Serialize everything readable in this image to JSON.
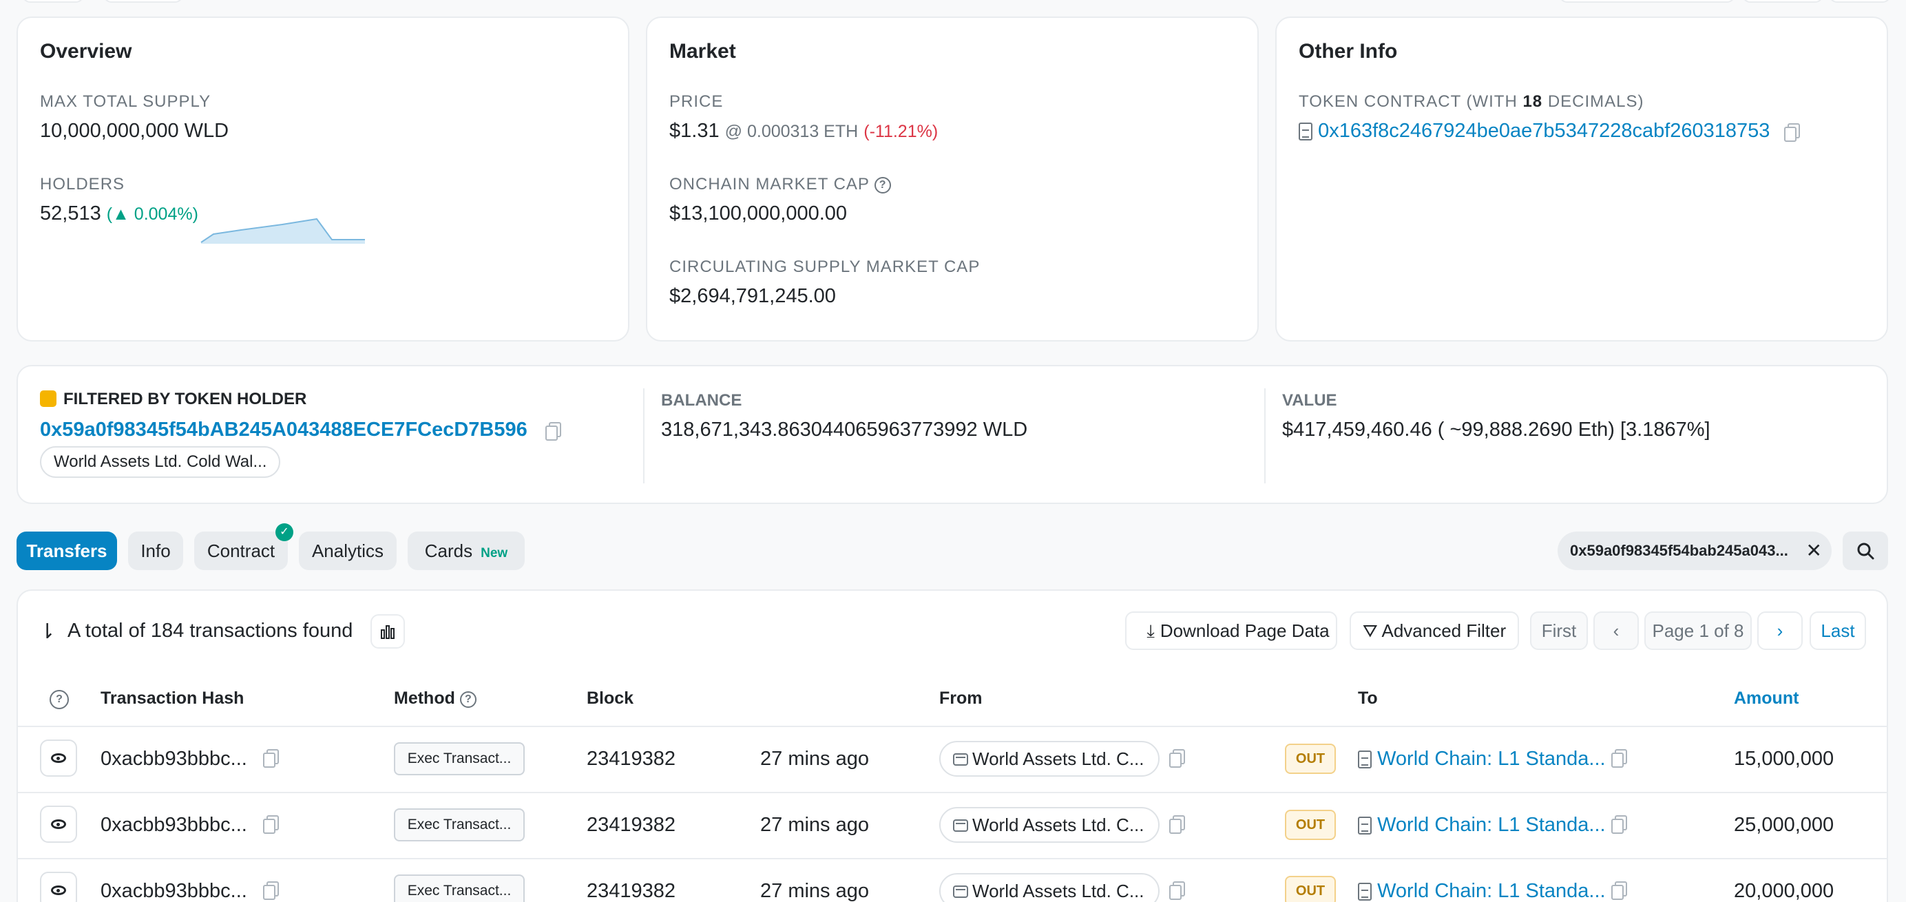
{
  "overview": {
    "title": "Overview",
    "max_supply_label": "MAX TOTAL SUPPLY",
    "max_supply_value": "10,000,000,000 WLD",
    "holders_label": "HOLDERS",
    "holders_value": "52,513",
    "holders_change": "0.004%"
  },
  "market": {
    "title": "Market",
    "price_label": "PRICE",
    "price_value": "$1.31",
    "price_eth": "@ 0.000313 ETH",
    "price_change": "(-11.21%)",
    "mcap_label": "ONCHAIN MARKET CAP",
    "mcap_value": "$13,100,000,000.00",
    "circ_label": "CIRCULATING SUPPLY MARKET CAP",
    "circ_value": "$2,694,791,245.00"
  },
  "other_info": {
    "title": "Other Info",
    "contract_label_pre": "TOKEN CONTRACT (WITH ",
    "contract_decimals": "18",
    "contract_label_post": " DECIMALS)",
    "contract_address": "0x163f8c2467924be0ae7b5347228cabf260318753"
  },
  "filter": {
    "label": "FILTERED BY TOKEN HOLDER",
    "address": "0x59a0f98345f54bAB245A043488ECE7FCecD7B596",
    "name_tag": "World Assets Ltd. Cold Wal...",
    "balance_label": "BALANCE",
    "balance_value": "318,671,343.863044065963773992 WLD",
    "value_label": "VALUE",
    "value_value": "$417,459,460.46 ( ~99,888.2690 Eth) [3.1867%]"
  },
  "tabs": {
    "transfers": "Transfers",
    "info": "Info",
    "contract": "Contract",
    "analytics": "Analytics",
    "cards": "Cards",
    "cards_badge": "New"
  },
  "search_filter": {
    "value": "0x59a0f98345f54bab245a043..."
  },
  "toolbar": {
    "total_text": "A total of 184 transactions found",
    "download": "Download Page Data",
    "advanced_filter": "Advanced Filter",
    "first": "First",
    "page_info": "Page 1 of 8",
    "last": "Last"
  },
  "table": {
    "headers": {
      "hash": "Transaction Hash",
      "method": "Method",
      "block": "Block",
      "from": "From",
      "to": "To",
      "amount": "Amount"
    },
    "rows": [
      {
        "hash": "0xacbb93bbbc...",
        "method": "Exec Transact...",
        "block": "23419382",
        "age": "27 mins ago",
        "from": "World Assets Ltd. C...",
        "dir": "OUT",
        "to": "World Chain: L1 Standa...",
        "amount": "15,000,000"
      },
      {
        "hash": "0xacbb93bbbc...",
        "method": "Exec Transact...",
        "block": "23419382",
        "age": "27 mins ago",
        "from": "World Assets Ltd. C...",
        "dir": "OUT",
        "to": "World Chain: L1 Standa...",
        "amount": "25,000,000"
      },
      {
        "hash": "0xacbb93bbbc...",
        "method": "Exec Transact...",
        "block": "23419382",
        "age": "27 mins ago",
        "from": "World Assets Ltd. C...",
        "dir": "OUT",
        "to": "World Chain: L1 Standa...",
        "amount": "20,000,000"
      }
    ]
  },
  "colors": {
    "link": "#0784c3",
    "positive": "#00a186",
    "negative": "#dc3545",
    "out_badge": "#b47d00"
  }
}
